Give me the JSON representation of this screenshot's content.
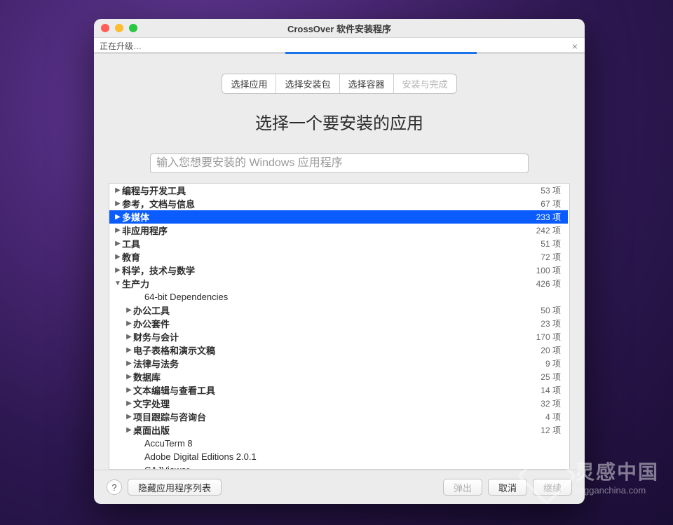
{
  "window": {
    "title": "CrossOver 软件安装程序"
  },
  "upgrade": {
    "text": "正在升级…"
  },
  "steps": {
    "s1": "选择应用",
    "s2": "选择安装包",
    "s3": "选择容器",
    "s4": "安装与完成"
  },
  "heading": "选择一个要安装的应用",
  "search": {
    "placeholder": "输入您想要安装的 Windows 应用程序"
  },
  "count_suffix": " 项",
  "categories": {
    "c0": {
      "label": "编程与开发工具",
      "count": "53"
    },
    "c1": {
      "label": "参考，文档与信息",
      "count": "67"
    },
    "c2": {
      "label": "多媒体",
      "count": "233"
    },
    "c3": {
      "label": "非应用程序",
      "count": "242"
    },
    "c4": {
      "label": "工具",
      "count": "51"
    },
    "c5": {
      "label": "教育",
      "count": "72"
    },
    "c6": {
      "label": "科学，技术与数学",
      "count": "100"
    },
    "c7": {
      "label": "生产力",
      "count": "426"
    },
    "c7_children": {
      "i0": {
        "label": "64-bit Dependencies"
      },
      "i1": {
        "label": "办公工具",
        "count": "50"
      },
      "i2": {
        "label": "办公套件",
        "count": "23"
      },
      "i3": {
        "label": "财务与会计",
        "count": "170"
      },
      "i4": {
        "label": "电子表格和演示文稿",
        "count": "20"
      },
      "i5": {
        "label": "法律与法务",
        "count": "9"
      },
      "i6": {
        "label": "数据库",
        "count": "25"
      },
      "i7": {
        "label": "文本编辑与查看工具",
        "count": "14"
      },
      "i8": {
        "label": "文字处理",
        "count": "32"
      },
      "i9": {
        "label": "项目跟踪与咨询台",
        "count": "4"
      },
      "i10": {
        "label": "桌面出版",
        "count": "12"
      },
      "i11": {
        "label": "AccuTerm 8"
      },
      "i12": {
        "label": "Adobe Digital Editions 2.0.1"
      },
      "i13": {
        "label": "CAJViewer"
      }
    }
  },
  "buttons": {
    "hide_list": "隐藏应用程序列表",
    "eject": "弹出",
    "cancel": "取消",
    "continue": "继续"
  },
  "watermark": {
    "cn": "灵感中国",
    "en": "lingganchina.com"
  }
}
